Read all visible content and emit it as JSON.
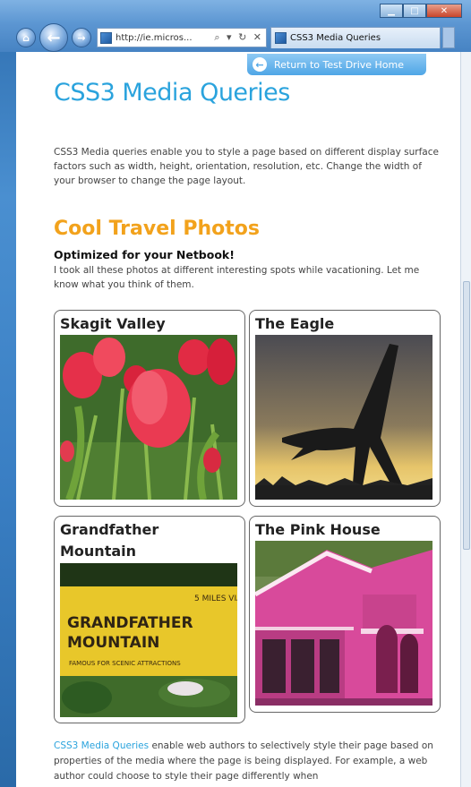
{
  "browser": {
    "address_url": "http://ie.micros...",
    "address_controls": "⌕ ▾ ↻ ✕",
    "tab_label": "CSS3 Media Queries",
    "return_button": "Return to Test Drive Home"
  },
  "page": {
    "title": "CSS3 Media Queries",
    "intro": "CSS3 Media queries enable you to style a page based on different display surface factors such as width, height, orientation, resolution, etc. Change the width of your browser to change the page layout.",
    "section_title": "Cool Travel Photos",
    "subtitle": "Optimized for your Netbook!",
    "sub_description": "I took all these photos at different interesting spots while vacationing. Let me know what you think of them.",
    "photos": [
      {
        "title": "Skagit Valley"
      },
      {
        "title": "The Eagle"
      },
      {
        "title": "Grandfather Mountain"
      },
      {
        "title": "The Pink House"
      }
    ],
    "sign_text": [
      "GRANDFATHER",
      "MOUNTAIN"
    ],
    "footer_link": "CSS3 Media Queries",
    "footer_text": " enable web authors to selectively style their page based on properties of the media where the page is being displayed. For example, a web author could choose to style their page differently when"
  }
}
